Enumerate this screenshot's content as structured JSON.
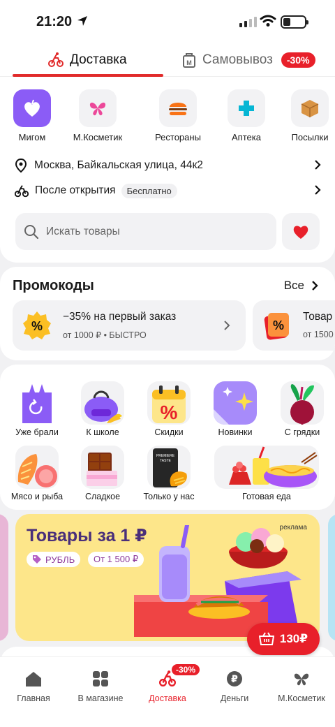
{
  "status_bar": {
    "time": "21:20"
  },
  "tabs": {
    "delivery": "Доставка",
    "pickup": "Самовывоз",
    "pickup_badge": "-30%"
  },
  "services": [
    {
      "label": "Мигом",
      "icon": "heart-fruit-icon",
      "color": "#8b5cf6"
    },
    {
      "label": "М.Косметик",
      "icon": "butterfly-icon",
      "color": "#ec4899"
    },
    {
      "label": "Рестораны",
      "icon": "burger-icon",
      "color": "#f97316"
    },
    {
      "label": "Аптека",
      "icon": "cross-icon",
      "color": "#06b6d4"
    },
    {
      "label": "Посылки",
      "icon": "box-icon",
      "color": "#d99444"
    }
  ],
  "address": "Москва, Байкальская улица, 44к2",
  "delivery_time": {
    "text": "После открытия",
    "pill": "Бесплатно"
  },
  "search": {
    "placeholder": "Искать товары"
  },
  "promo": {
    "title": "Промокоды",
    "all_label": "Все",
    "cards": [
      {
        "title": "−35% на первый заказ",
        "subtitle": "от 1000 ₽ • БЫСТРО"
      },
      {
        "title": "Товар",
        "subtitle": "от 1500"
      }
    ]
  },
  "categories": [
    {
      "label": "Уже брали"
    },
    {
      "label": "К школе"
    },
    {
      "label": "Скидки"
    },
    {
      "label": "Новинки"
    },
    {
      "label": "С грядки"
    },
    {
      "label": "Мясо и рыба"
    },
    {
      "label": "Сладкое"
    },
    {
      "label": "Только у нас"
    },
    {
      "label": "Готовая еда"
    }
  ],
  "banner": {
    "title": "Товары за 1 ₽",
    "tag1": "РУБЛЬ",
    "tag2": "От 1 500 ₽",
    "ad": "реклама",
    "product_text": "PREMIERE OF TASTE"
  },
  "cart": {
    "total": "130₽"
  },
  "nav": {
    "items": [
      {
        "label": "Главная"
      },
      {
        "label": "В магазине"
      },
      {
        "label": "Доставка"
      },
      {
        "label": "Деньги"
      },
      {
        "label": "М.Косметик"
      }
    ],
    "badge": "-30%"
  },
  "colors": {
    "accent": "#e8202a",
    "banner_bg": "#fde68a",
    "banner_title": "#4a2f7a"
  }
}
